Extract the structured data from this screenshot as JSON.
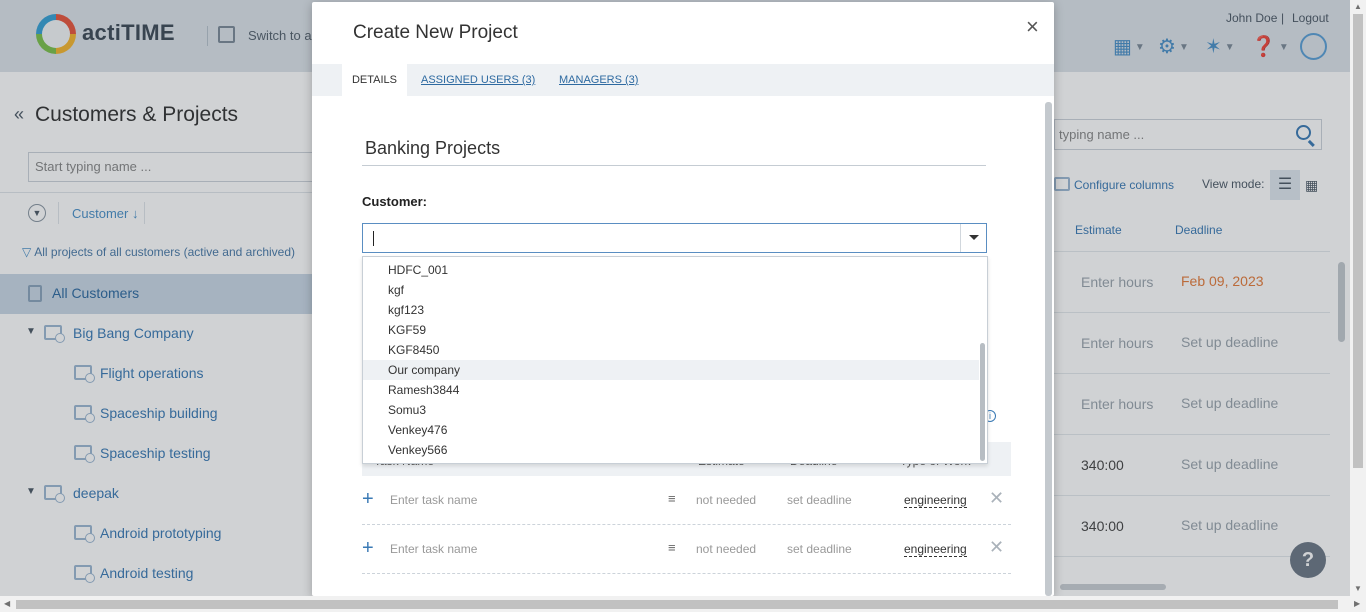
{
  "header": {
    "app_name": "actiTIME",
    "switch_text": "Switch to a",
    "user_name": "John Doe",
    "separator": "|",
    "logout": "Logout",
    "icons": [
      "calendar-icon",
      "gear-icon",
      "puzzle-icon",
      "help-icon",
      "lightbulb-icon"
    ]
  },
  "left": {
    "title": "Customers & Projects",
    "search_placeholder": "Start typing name ...",
    "sort_label": "Customer ↓",
    "filter_text": "All projects of all customers (active and archived)",
    "tree": [
      {
        "label": "All Customers",
        "kind": "all",
        "selected": true
      },
      {
        "label": "Big Bang Company",
        "kind": "customer"
      },
      {
        "label": "Flight operations",
        "kind": "project"
      },
      {
        "label": "Spaceship building",
        "kind": "project"
      },
      {
        "label": "Spaceship testing",
        "kind": "project"
      },
      {
        "label": "deepak",
        "kind": "customer"
      },
      {
        "label": "Android prototyping",
        "kind": "project"
      },
      {
        "label": "Android testing",
        "kind": "project"
      }
    ]
  },
  "right": {
    "search_placeholder": "typing name ...",
    "configure_columns": "Configure columns",
    "view_mode": "View mode:",
    "columns": [
      "Estimate",
      "Deadline"
    ],
    "rows": [
      {
        "estimate": "Enter hours",
        "deadline": "Feb 09, 2023"
      },
      {
        "estimate": "Enter hours",
        "deadline": "Set up deadline"
      },
      {
        "estimate": "Enter hours",
        "deadline": "Set up deadline"
      },
      {
        "estimate": "340:00",
        "deadline": "Set up deadline"
      },
      {
        "estimate": "340:00",
        "deadline": "Set up deadline"
      }
    ],
    "help": "?"
  },
  "modal": {
    "title": "Create New Project",
    "close": "×",
    "tabs": [
      "DETAILS",
      "ASSIGNED USERS (3)",
      "MANAGERS (3)"
    ],
    "project_name": "Banking Projects",
    "customer_label": "Customer:",
    "customer_value": "",
    "dropdown_options": [
      "HDFC_001",
      "kgf",
      "kgf123",
      "KGF59",
      "KGF8450",
      "Our company",
      "Ramesh3844",
      "Somu3",
      "Venkey476",
      "Venkey566"
    ],
    "hovered_option": "Our company",
    "task_columns": [
      "Task Name",
      "Estimate",
      "Deadline",
      "Type of Work"
    ],
    "task_rows": [
      {
        "name_placeholder": "Enter task name",
        "estimate": "not needed",
        "deadline": "set deadline",
        "type": "engineering"
      },
      {
        "name_placeholder": "Enter task name",
        "estimate": "not needed",
        "deadline": "set deadline",
        "type": "engineering"
      }
    ]
  }
}
